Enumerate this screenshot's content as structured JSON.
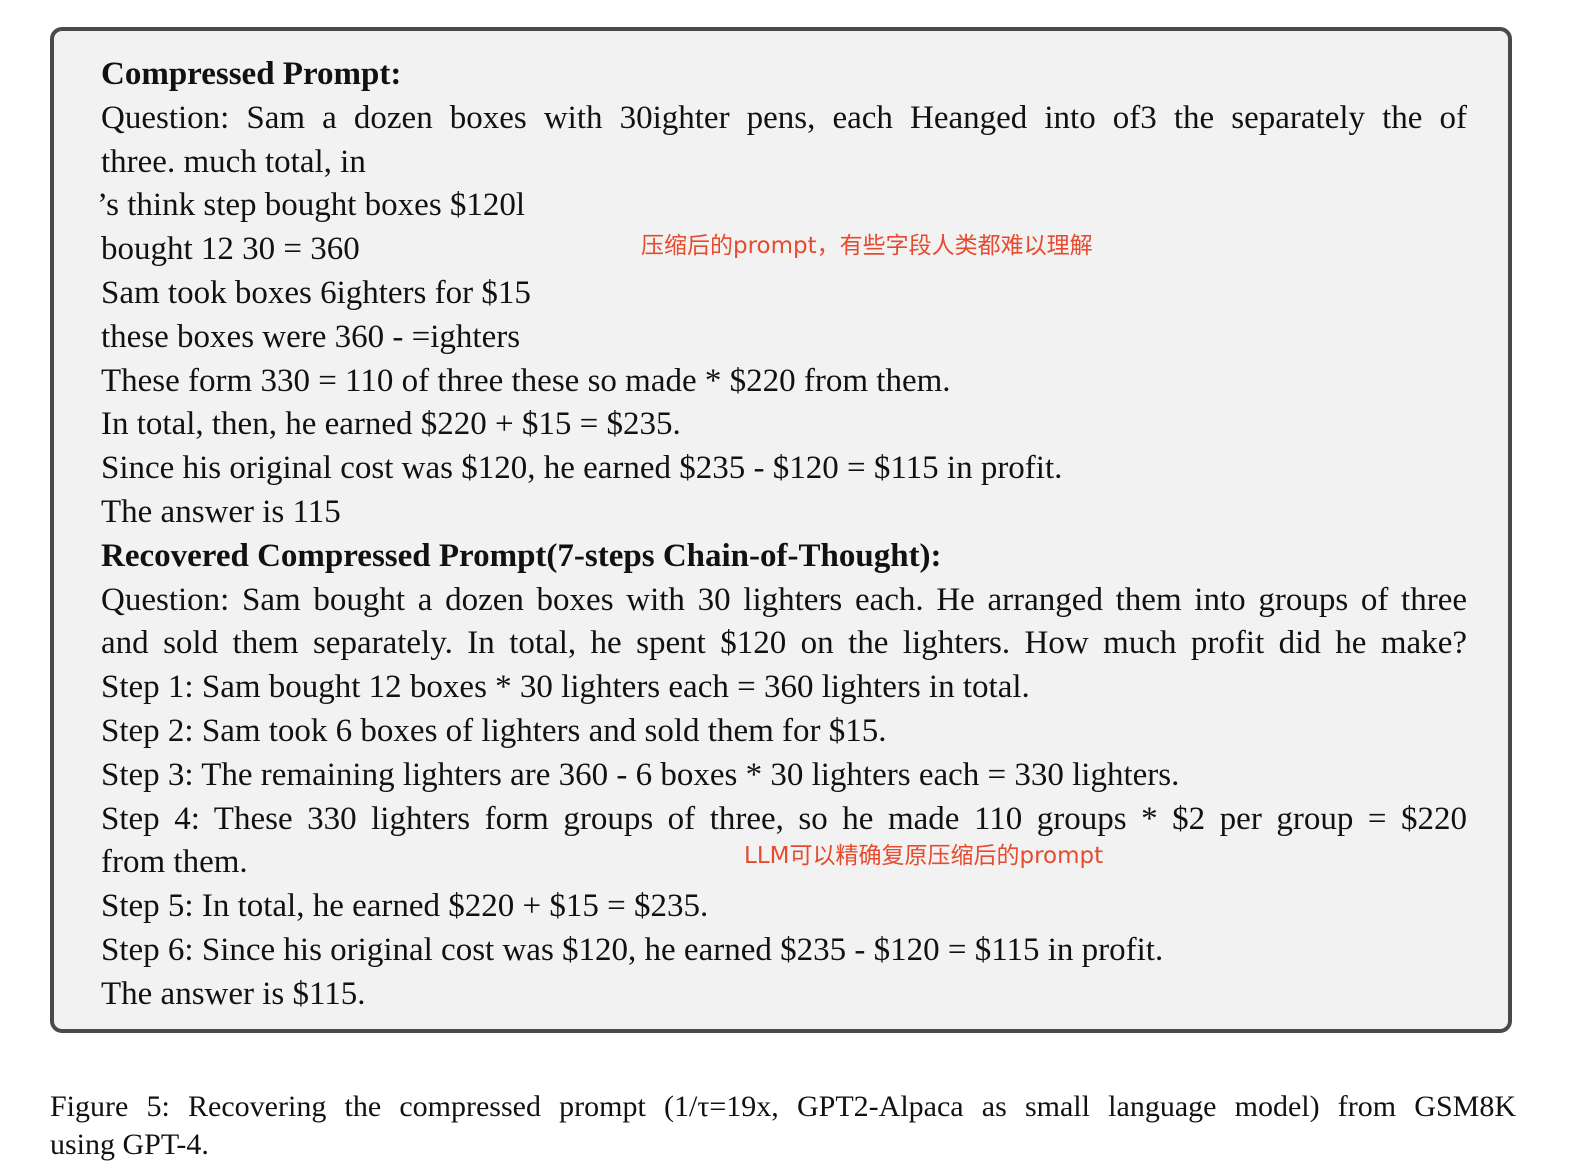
{
  "compressed": {
    "heading": "Compressed Prompt:",
    "lines": [
      "Question: Sam a dozen boxes with 30ighter pens, each Heanged into of3 the separately the of",
      "three. much total, in",
      "’s think step bought boxes $120l",
      "bought 12 30 = 360",
      "Sam took boxes 6ighters for $15",
      "these boxes were 360 - =ighters",
      "These form 330 = 110 of three these so made * $220 from them.",
      "In total, then, he earned $220 + $15 = $235.",
      "Since his original cost was $120, he earned $235 - $120 = $115 in profit.",
      "The answer is 115"
    ],
    "annotation": "压缩后的prompt，有些字段人类都难以理解"
  },
  "recovered": {
    "heading": "Recovered Compressed Prompt(7-steps Chain-of-Thought):",
    "lines": [
      "Question: Sam bought a dozen boxes with 30 lighters each. He arranged them into groups of three",
      "and sold them separately. In total, he spent $120 on the lighters. How much profit did he make?",
      "Step 1: Sam bought 12 boxes * 30 lighters each = 360 lighters in total.",
      "Step 2: Sam took 6 boxes of lighters and sold them for $15.",
      "Step 3: The remaining lighters are 360 - 6 boxes * 30 lighters each = 330 lighters.",
      "Step 4: These 330 lighters form groups of three, so he made 110 groups * $2 per group = $220",
      "from them.",
      "Step 5: In total, he earned $220 + $15 = $235.",
      "Step 6: Since his original cost was $120, he earned $235 - $120 = $115 in profit.",
      "The answer is $115."
    ],
    "annotation": "LLM可以精确复原压缩后的prompt"
  },
  "caption": {
    "line1": "Figure 5: Recovering the compressed prompt (1/τ=19x, GPT2-Alpaca as small language model) from GSM8K",
    "line2": "using GPT-4."
  }
}
